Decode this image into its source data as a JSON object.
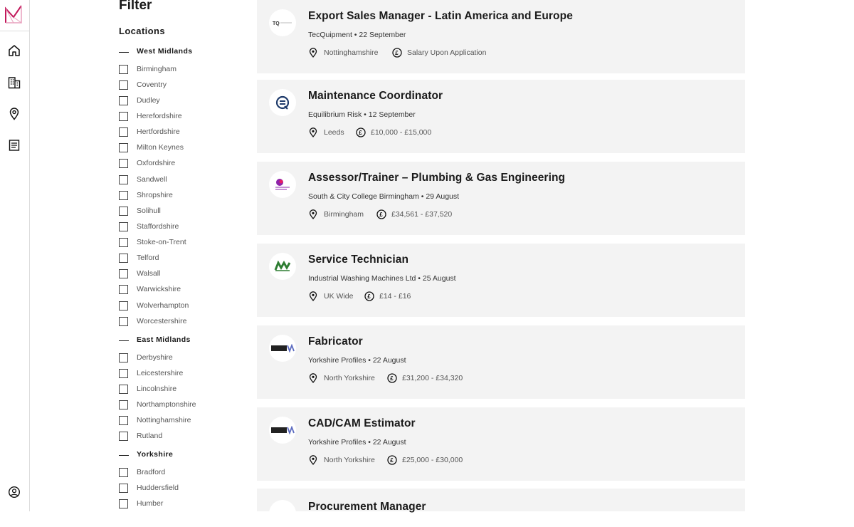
{
  "colors": {
    "accent": "#c2185b",
    "card_bg": "#f3f3f3",
    "text": "#1a1a1a",
    "muted": "#555555"
  },
  "nav": {
    "icons": [
      "brand-logo-icon",
      "home-icon",
      "building-icon",
      "location-pin-icon",
      "document-icon",
      "account-icon"
    ]
  },
  "filter": {
    "title": "Filter",
    "section_title": "Locations",
    "regions": [
      {
        "name": "West Midlands",
        "locations": [
          "Birmingham",
          "Coventry",
          "Dudley",
          "Herefordshire",
          "Hertfordshire",
          "Milton Keynes",
          "Oxfordshire",
          "Sandwell",
          "Shropshire",
          "Solihull",
          "Staffordshire",
          "Stoke-on-Trent",
          "Telford",
          "Walsall",
          "Warwickshire",
          "Wolverhampton",
          "Worcestershire"
        ]
      },
      {
        "name": "East Midlands",
        "locations": [
          "Derbyshire",
          "Leicestershire",
          "Lincolnshire",
          "Northamptonshire",
          "Nottinghamshire",
          "Rutland"
        ]
      },
      {
        "name": "Yorkshire",
        "locations": [
          "Bradford",
          "Huddersfield",
          "Humber"
        ]
      }
    ]
  },
  "jobs": [
    {
      "title": "Export Sales Manager - Latin America and Europe",
      "company": "TecQuipment",
      "date": "22 September",
      "meta": "TecQuipment • 22 September",
      "location": "Nottinghamshire",
      "salary": "Salary Upon Application",
      "logo": "tecquipment-logo-icon"
    },
    {
      "title": "Maintenance Coordinator",
      "company": "Equilibrium Risk",
      "date": "12 September",
      "meta": "Equilibrium Risk • 12 September",
      "location": "Leeds",
      "salary": "£10,000 - £15,000",
      "logo": "equilibrium-risk-logo-icon"
    },
    {
      "title": "Assessor/Trainer – Plumbing & Gas Engineering",
      "company": "South & City College Birmingham",
      "date": "29 August",
      "meta": "South & City College Birmingham • 29 August",
      "location": "Birmingham",
      "salary": "£34,561 - £37,520",
      "logo": "south-city-college-logo-icon"
    },
    {
      "title": "Service Technician",
      "company": "Industrial Washing Machines Ltd",
      "date": "25 August",
      "meta": "Industrial Washing Machines Ltd • 25 August",
      "location": "UK Wide",
      "salary": "£14 - £16",
      "logo": "iwm-logo-icon"
    },
    {
      "title": "Fabricator",
      "company": "Yorkshire Profiles",
      "date": "22 August",
      "meta": "Yorkshire Profiles • 22 August",
      "location": "North Yorkshire",
      "salary": "£31,200 - £34,320",
      "logo": "yorkshire-profiles-logo-icon"
    },
    {
      "title": "CAD/CAM Estimator",
      "company": "Yorkshire Profiles",
      "date": "22 August",
      "meta": "Yorkshire Profiles • 22 August",
      "location": "North Yorkshire",
      "salary": "£25,000 - £30,000",
      "logo": "yorkshire-profiles-logo-icon"
    },
    {
      "title": "Procurement Manager"
    }
  ]
}
